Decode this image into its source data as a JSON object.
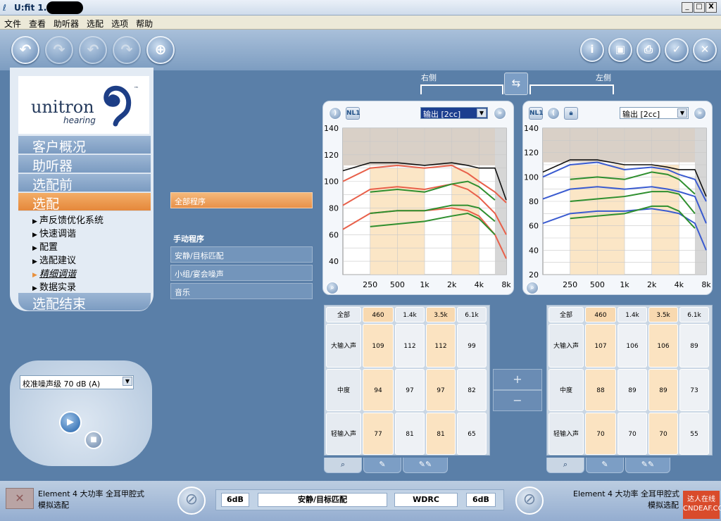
{
  "window": {
    "title": "U:fit 1.2",
    "min": "_",
    "max": "□",
    "close": "X"
  },
  "menu": [
    "文件",
    "查看",
    "助听器",
    "选配",
    "选项",
    "帮助"
  ],
  "logo": {
    "brand": "unitron",
    "sub": "hearing",
    "tm": "™"
  },
  "nav": {
    "main": [
      "客户概况",
      "助听器",
      "选配前",
      "选配"
    ],
    "sub": [
      "声反馈优化系统",
      "快速调谐",
      "配置",
      "选配建议",
      "精细调谐",
      "数据实录"
    ],
    "end": "选配结束"
  },
  "programs": {
    "all": "全部程序",
    "manual_header": "手动程序",
    "items": [
      "安静/目标匹配",
      "小组/宴会噪声",
      "音乐"
    ]
  },
  "noise": {
    "select": "校准噪声级 70 dB (A)"
  },
  "sides": {
    "right": "右侧",
    "left": "左侧"
  },
  "graph": {
    "output_select": "输出 [2cc]",
    "nl1": "NL1",
    "y_right": [
      "140",
      "120",
      "100",
      "80",
      "60",
      "40"
    ],
    "y_left": [
      "140",
      "120",
      "100",
      "80",
      "60",
      "40",
      "20"
    ],
    "x_ticks": [
      "250",
      "500",
      "1k",
      "2k",
      "4k",
      "8k"
    ]
  },
  "table": {
    "header_all": "全部",
    "cols": [
      "460",
      "1.4k",
      "3.5k",
      "6.1k"
    ],
    "rows": [
      "大输入声",
      "中度",
      "轻输入声"
    ],
    "right": [
      [
        "109",
        "112",
        "112",
        "99"
      ],
      [
        "94",
        "97",
        "97",
        "82"
      ],
      [
        "77",
        "81",
        "81",
        "65"
      ]
    ],
    "left": [
      [
        "107",
        "106",
        "106",
        "89"
      ],
      [
        "88",
        "89",
        "89",
        "73"
      ],
      [
        "70",
        "70",
        "70",
        "55"
      ]
    ],
    "plus": "+",
    "minus": "−"
  },
  "status": {
    "left_line1": "Element  4  大功率  全耳甲腔式",
    "left_line2": "模拟选配",
    "right_line1": "Element  4  大功率  全耳甲腔式",
    "right_line2": "模拟选配",
    "db_left": "6dB",
    "program": "安静/目标匹配",
    "mode": "WDRC",
    "db_right": "6dB"
  },
  "watermark": "达人在线 CNDEAF.COM",
  "colors": {
    "accent": "#e8913f",
    "panel": "#5a7fa8",
    "curve_red": "#e8604a",
    "curve_green": "#2f8f2f",
    "curve_blue": "#3a5bd0",
    "curve_black": "#111111"
  }
}
